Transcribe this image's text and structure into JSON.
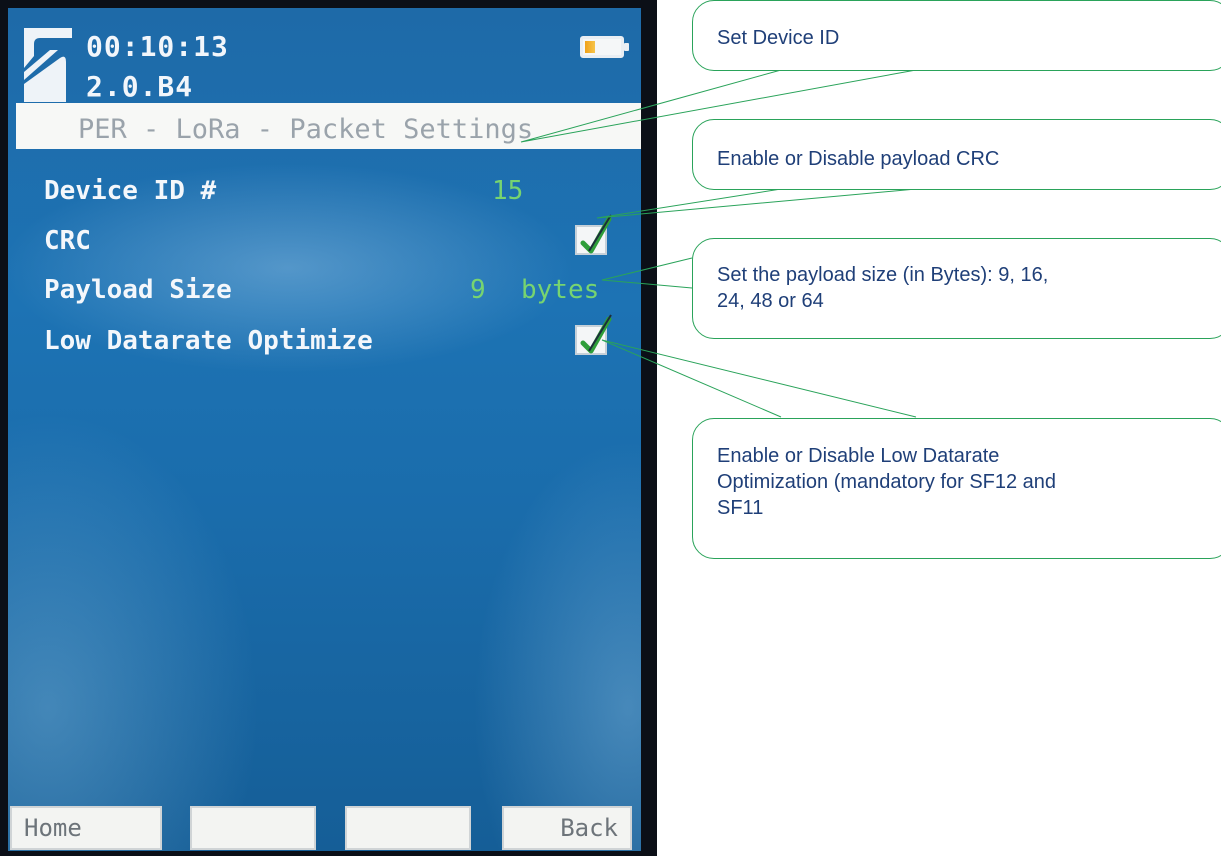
{
  "device": {
    "clock": "00:10:13",
    "version": "2.0.B4",
    "battery_icon": "battery-icon",
    "logo_icon": "s-logo-icon",
    "battery_level": 0.3
  },
  "screen": {
    "title": "PER - LoRa - Packet Settings",
    "rows": [
      {
        "label": "Device ID #",
        "value": "15"
      },
      {
        "label": "CRC",
        "checked": true
      },
      {
        "label": "Payload Size",
        "value": "9",
        "unit": "bytes"
      },
      {
        "label": "Low Datarate Optimize",
        "checked": true
      }
    ]
  },
  "softkeys": [
    "Home",
    "",
    "",
    "Back"
  ],
  "callouts": [
    {
      "text": "Set Device ID"
    },
    {
      "text": "Enable or Disable payload CRC"
    },
    {
      "lines": [
        "Set the payload size (in Bytes): 9, 16,",
        "24, 48 or 64"
      ]
    },
    {
      "lines": [
        "Enable or Disable Low Datarate",
        "Optimization (mandatory for SF12 and",
        "SF11"
      ]
    }
  ],
  "colors": {
    "screen_blue": "#1d73b4",
    "value_green": "#77d470",
    "callout_border": "#2aa35a",
    "callout_text": "#1f3f78"
  }
}
